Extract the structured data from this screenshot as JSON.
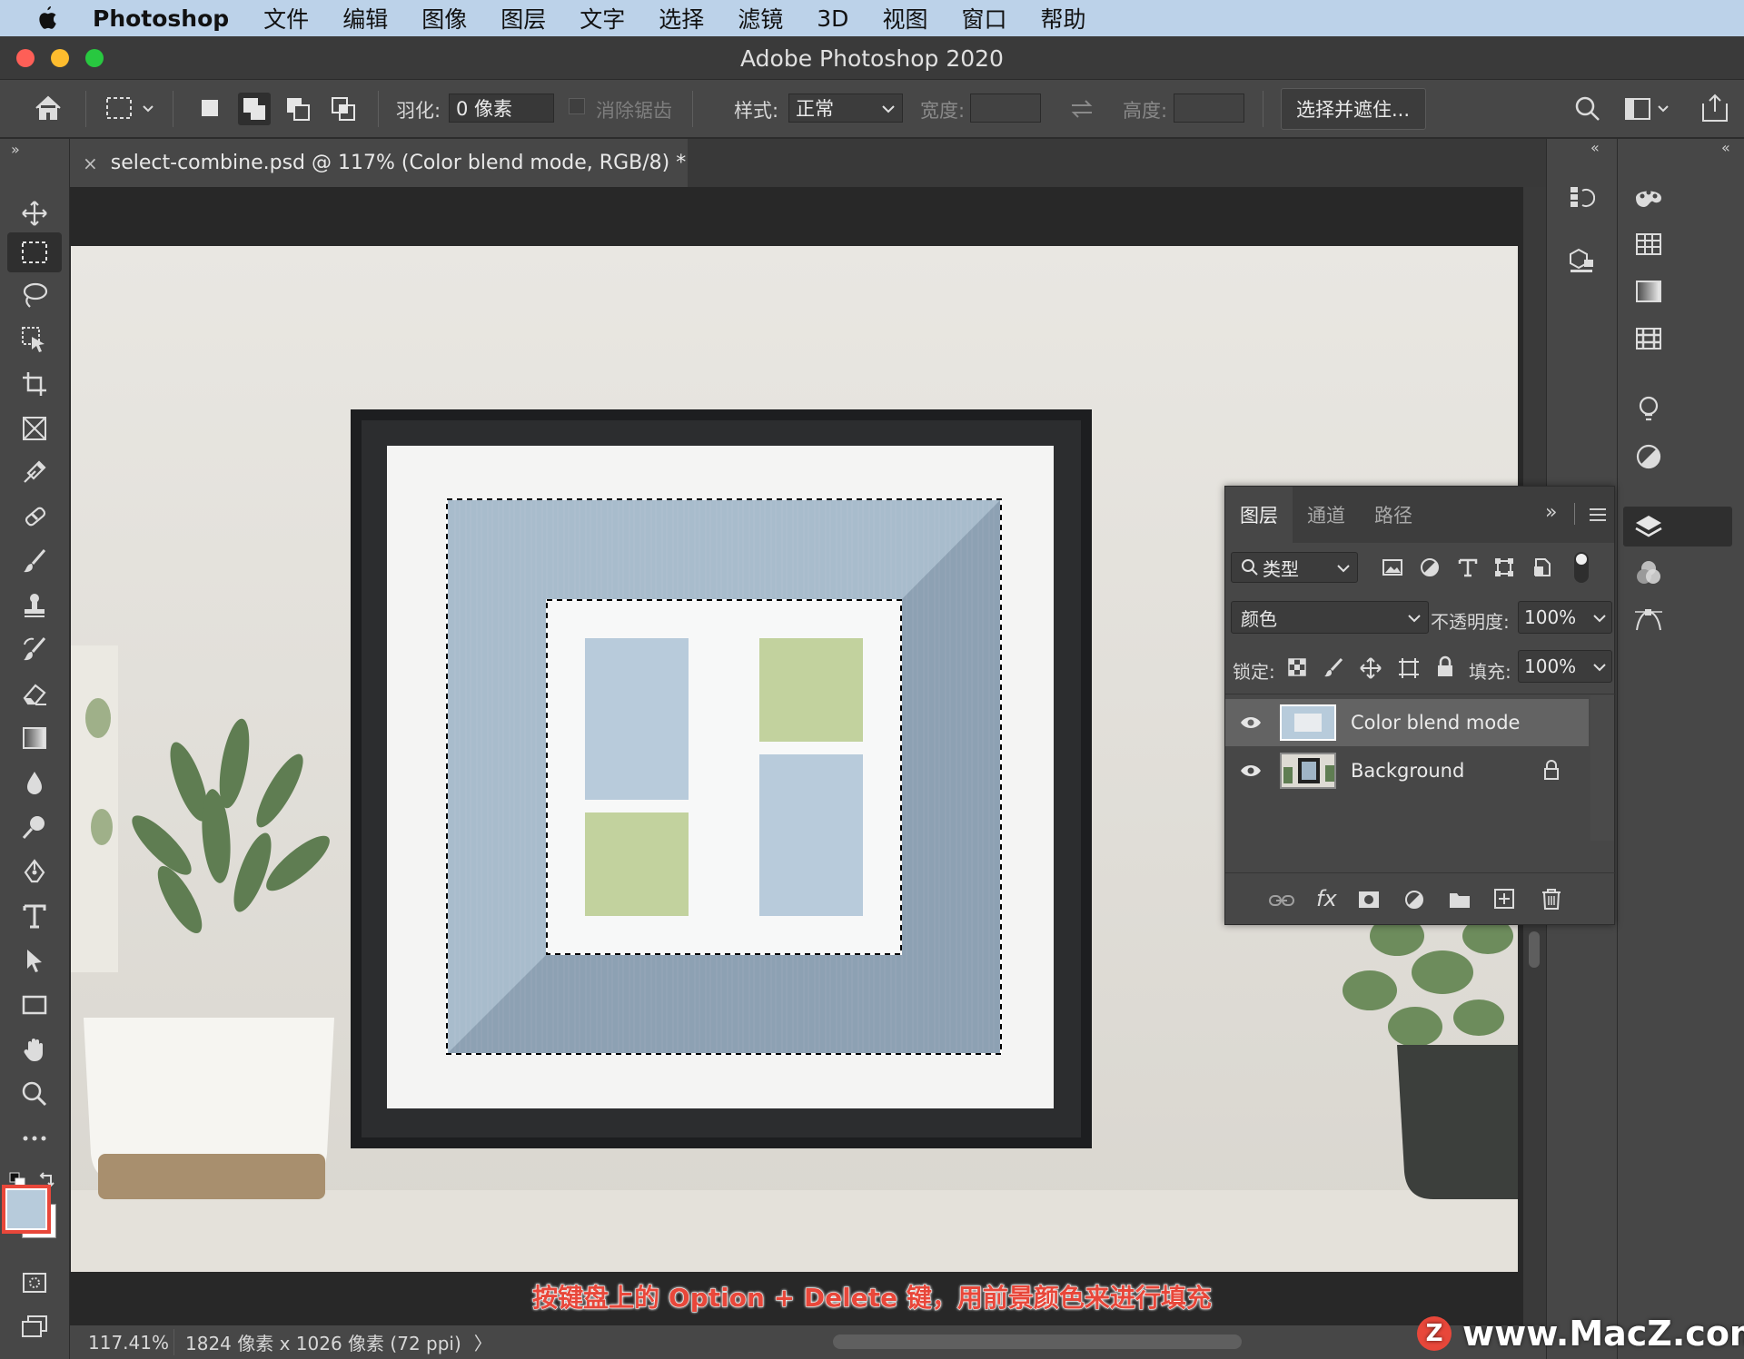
{
  "menubar": {
    "app": "Photoshop",
    "items": [
      "文件",
      "编辑",
      "图像",
      "图层",
      "文字",
      "选择",
      "滤镜",
      "3D",
      "视图",
      "窗口",
      "帮助"
    ]
  },
  "window": {
    "title": "Adobe Photoshop 2020"
  },
  "options": {
    "feather_label": "羽化:",
    "feather_value": "0 像素",
    "antialias_label": "消除锯齿",
    "style_label": "样式:",
    "style_value": "正常",
    "width_label": "宽度:",
    "height_label": "高度:",
    "select_mask_button": "选择并遮住..."
  },
  "document": {
    "tab_label": "select-combine.psd @ 117% (Color blend mode, RGB/8) *",
    "close": "×"
  },
  "status": {
    "zoom": "117.41%",
    "info": "1824 像素 x 1026 像素 (72 ppi)",
    "arrow": "〉"
  },
  "caption": "按键盘上的 Option + Delete 键，用前景颜色来进行填充",
  "layers_panel": {
    "tabs": [
      "图层",
      "通道",
      "路径"
    ],
    "filter_label": "类型",
    "blend_mode": "颜色",
    "opacity_label": "不透明度:",
    "opacity_value": "100%",
    "lock_label": "锁定:",
    "fill_label": "填充:",
    "fill_value": "100%",
    "layers": [
      {
        "name": "Color blend mode",
        "visible": true,
        "selected": true
      },
      {
        "name": "Background",
        "visible": true,
        "locked": true
      }
    ]
  },
  "colors": {
    "foreground": "#b7cbdb",
    "background": "#ffffff",
    "menubar": "#bcd2e9",
    "caption": "#e8473a"
  },
  "watermark": "www.MacZ.com"
}
